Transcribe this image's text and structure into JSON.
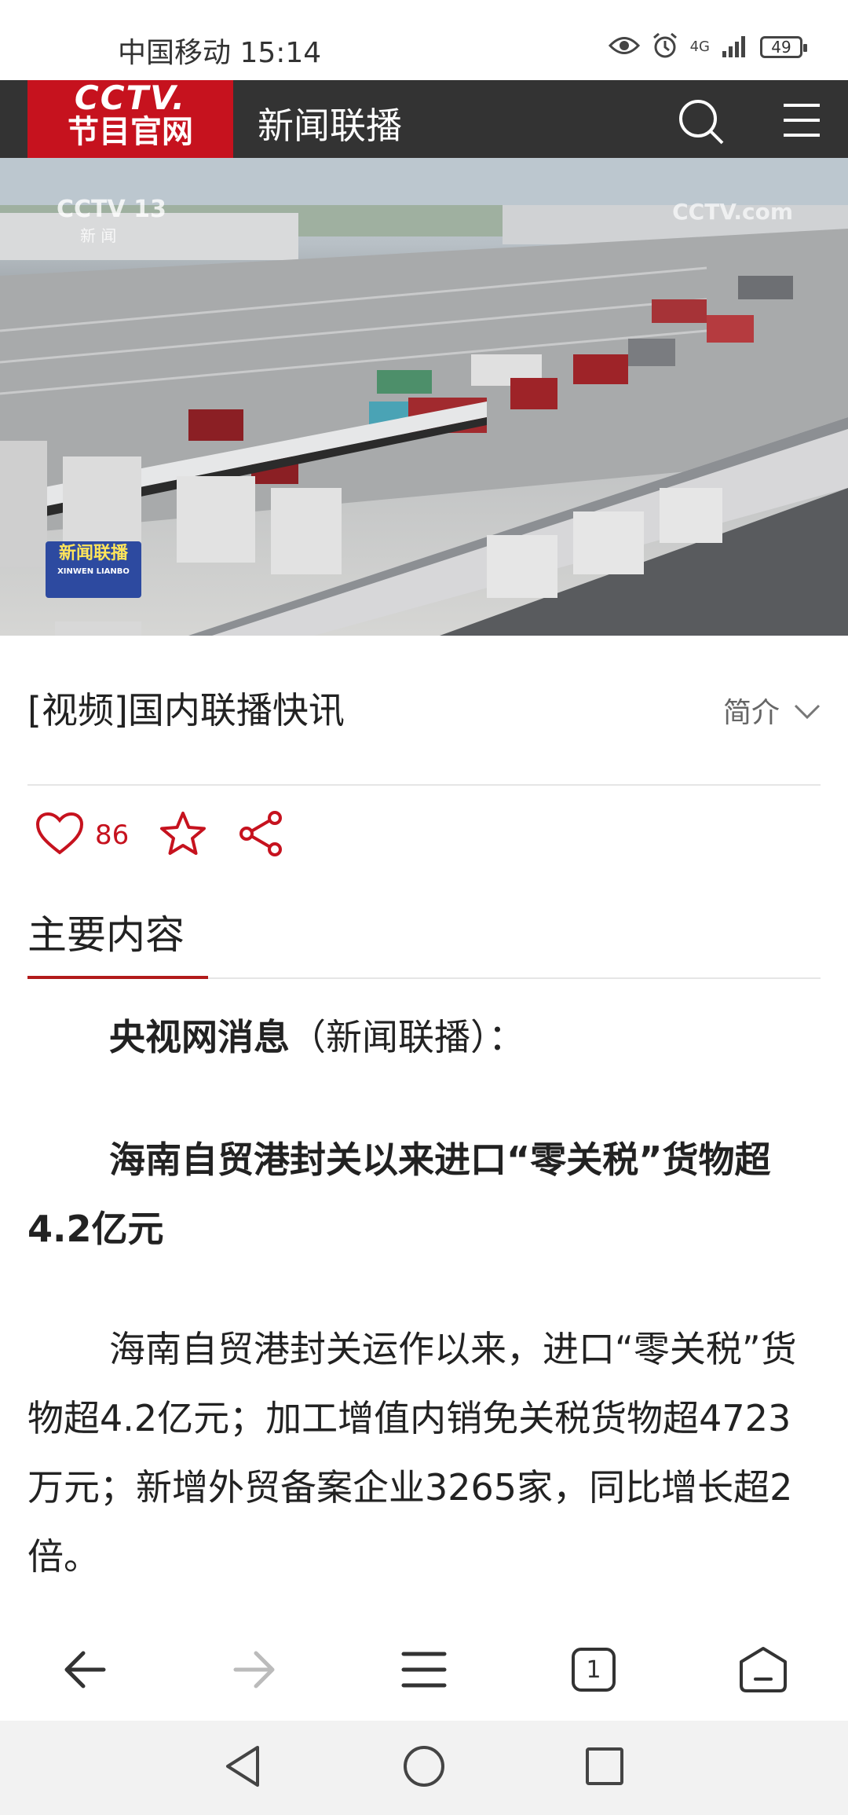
{
  "status": {
    "carrier_time": "中国移动 15:14",
    "network": "4G",
    "battery": "49",
    "icons": [
      "eye-icon",
      "alarm-icon",
      "signal-icon",
      "battery-icon"
    ]
  },
  "header": {
    "logo_line1": "CCTV.",
    "logo_line2": "节目官网",
    "title": "新闻联播",
    "brand_color": "#c6121e",
    "bg_color": "#333333"
  },
  "video": {
    "channel_watermark": "CCTV 13",
    "channel_sub": "新 闻",
    "watermark_right": "CCTV.com",
    "badge": "新闻联播",
    "badge_sub": "XINWEN LIANBO"
  },
  "article": {
    "title": "[视频]国内联播快讯",
    "intro_label": "简介",
    "likes": "86",
    "section_title": "主要内容",
    "p1_lead": "央视网消息",
    "p1_rest": "（新闻联播）：",
    "headline": "海南自贸港封关以来进口“零关税”货物超4.2亿元",
    "body": "海南自贸港封关运作以来，进口“零关税”货物超4.2亿元；加工增值内销免关税货物超4723万元；新增外贸备案企业3265家，同比增长超2倍。"
  },
  "toolbar": {
    "tab_count": "1",
    "items": [
      "back-icon",
      "forward-icon",
      "menu-icon",
      "tabs-icon",
      "home-icon"
    ]
  }
}
